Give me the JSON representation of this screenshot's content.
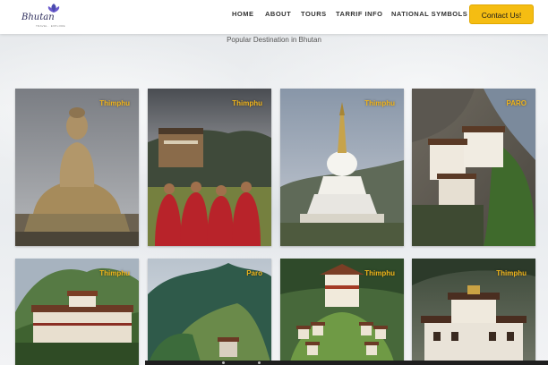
{
  "brand": {
    "name": "Bhutan",
    "tagline": "TRAVEL · EXPLORE",
    "logo_icon": "lotus-flower-icon",
    "colors": {
      "accent": "#f5bd12",
      "city_label": "#f2b51a",
      "logo": "#2a2a5a"
    }
  },
  "nav": {
    "items": [
      {
        "label": "HOME"
      },
      {
        "label": "ABOUT"
      },
      {
        "label": "TOURS"
      },
      {
        "label": "TARRIF INFO"
      },
      {
        "label": "NATIONAL SYMBOLS"
      }
    ],
    "contact_label": "Contact Us!"
  },
  "section": {
    "title": "Popular Destination in Bhutan"
  },
  "destinations": [
    {
      "city": "Thimphu",
      "image": "buddha-statue-photo"
    },
    {
      "city": "Thimphu",
      "image": "monks-in-red-robes-photo"
    },
    {
      "city": "Thimphu",
      "image": "white-stupa-memorial-photo"
    },
    {
      "city": "PARO",
      "image": "tigers-nest-monastery-photo"
    },
    {
      "city": "Thimphu",
      "image": "dzong-valley-photo"
    },
    {
      "city": "Paro",
      "image": "forested-mountains-photo"
    },
    {
      "city": "Thimphu",
      "image": "chortens-pass-photo"
    },
    {
      "city": "Thimphu",
      "image": "dzong-courtyard-photo"
    }
  ]
}
